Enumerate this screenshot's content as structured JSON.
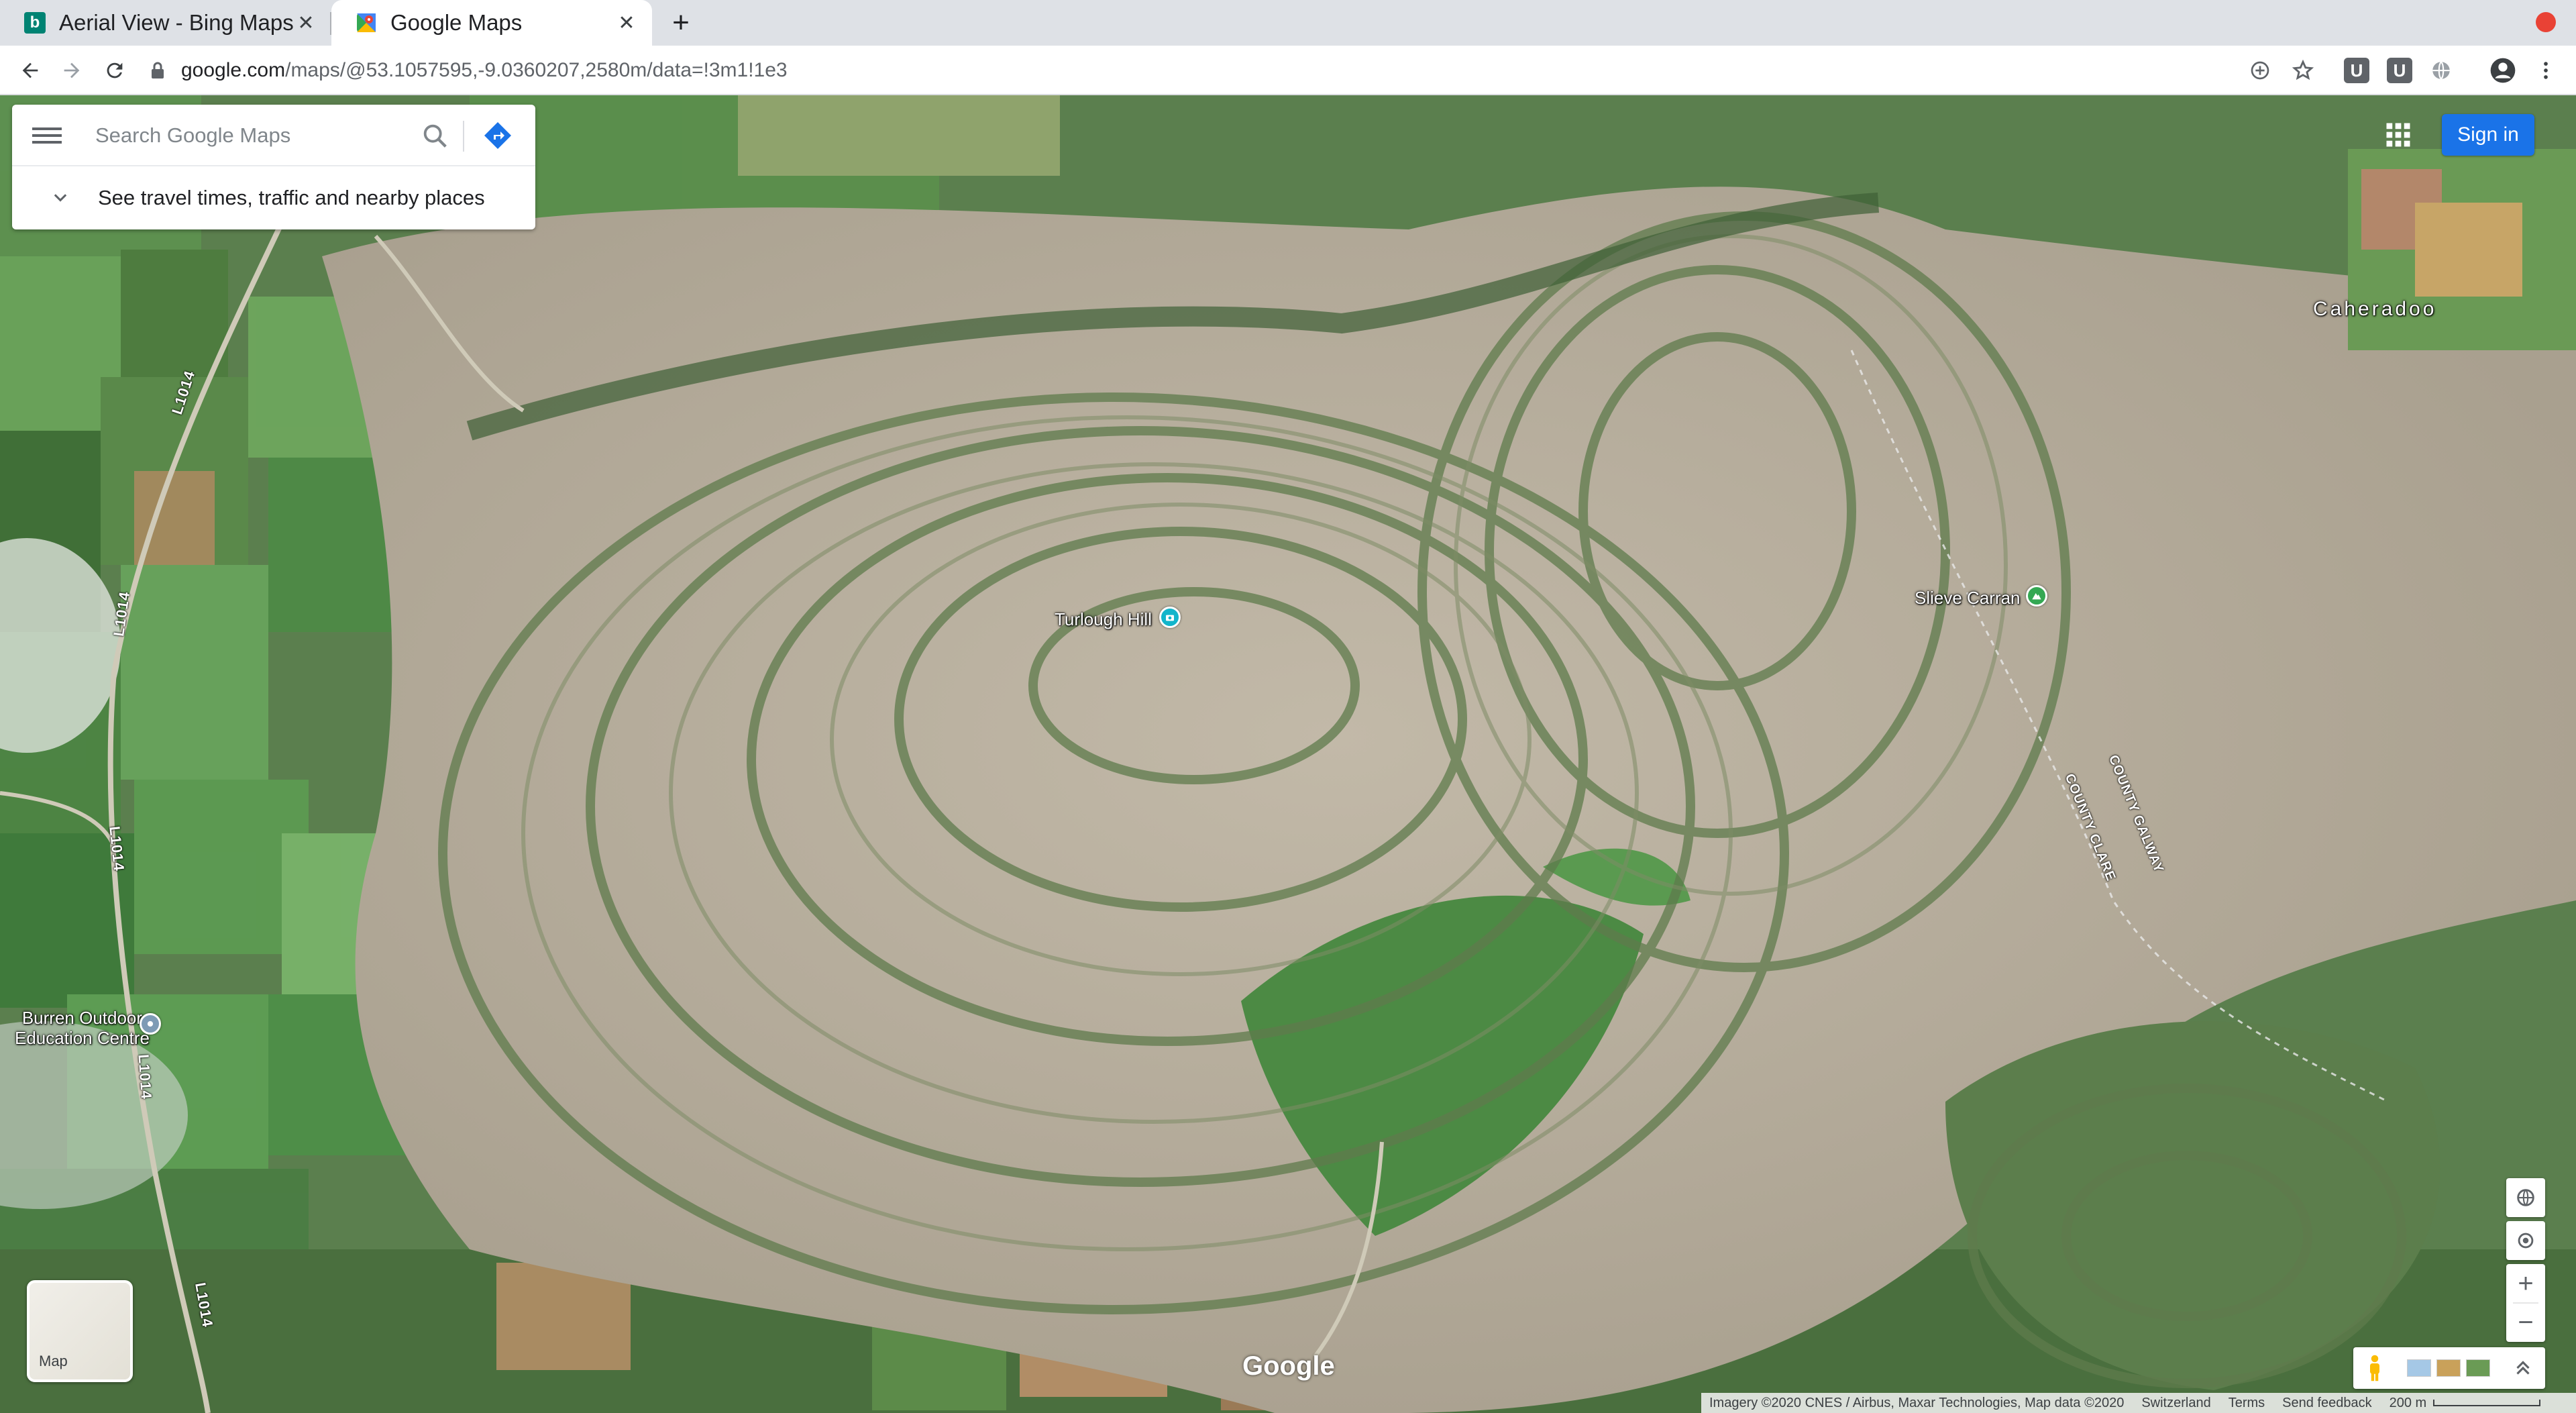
{
  "browser": {
    "tabs": [
      {
        "title": "Aerial View - Bing Maps",
        "favicon": "bing-icon",
        "active": false
      },
      {
        "title": "Google Maps",
        "favicon": "google-maps-icon",
        "active": true
      }
    ],
    "new_tab": "+",
    "url_host": "google.com",
    "url_path": "/maps/@53.1057595,-9.0360207,2580m/data=!3m1!1e3",
    "extensions": [
      "U",
      "U"
    ]
  },
  "search": {
    "placeholder": "Search Google Maps",
    "travel_prompt": "See travel times, traffic and nearby places"
  },
  "signin_label": "Sign in",
  "places": {
    "turlough_hill": "Turlough Hill",
    "slieve_carran": "Slieve Carran",
    "caheradoo": "Caheradoo",
    "burren_line1": "Burren Outdoor",
    "burren_line2": "Education Centre"
  },
  "roads": {
    "l1014": "L1014"
  },
  "borders": {
    "county_clare": "COUNTY CLARE",
    "county_galway": "COUNTY GALWAY"
  },
  "layer_toggle_label": "Map",
  "google_logo": "Google",
  "attribution": {
    "imagery": "Imagery ©2020 CNES / Airbus, Maxar Technologies, Map data ©2020",
    "country": "Switzerland",
    "terms": "Terms",
    "feedback": "Send feedback",
    "scale": "200 m"
  },
  "colors": {
    "accent": "#1a73e8",
    "karst": "#b7ae9d",
    "grass": "#4f7d45",
    "field": "#5f9a55"
  }
}
